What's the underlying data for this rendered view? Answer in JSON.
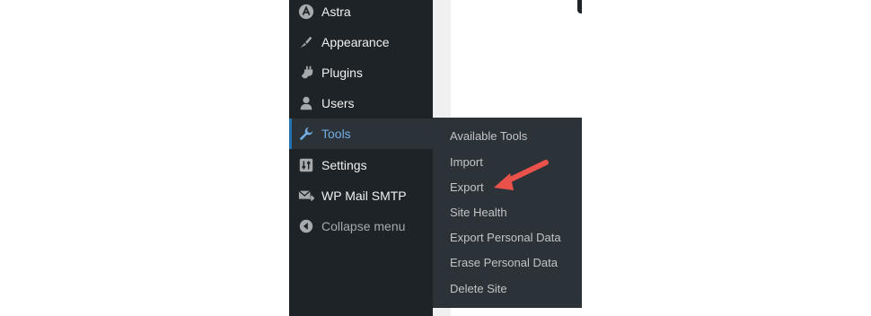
{
  "sidebar": {
    "items": [
      {
        "label": "Astra",
        "icon": "astra-icon"
      },
      {
        "label": "Appearance",
        "icon": "paintbrush-icon"
      },
      {
        "label": "Plugins",
        "icon": "plug-icon"
      },
      {
        "label": "Users",
        "icon": "user-icon"
      },
      {
        "label": "Tools",
        "icon": "wrench-icon",
        "active": true
      },
      {
        "label": "Settings",
        "icon": "sliders-icon"
      },
      {
        "label": "WP Mail SMTP",
        "icon": "mail-icon"
      }
    ],
    "collapse_label": "Collapse menu"
  },
  "tools_submenu": {
    "items": [
      "Available Tools",
      "Import",
      "Export",
      "Site Health",
      "Export Personal Data",
      "Erase Personal Data",
      "Delete Site"
    ]
  },
  "colors": {
    "sidebar_bg": "#1d2327",
    "flyout_bg": "#2c3338",
    "active_text": "#72aee6",
    "active_bar": "#2271b1",
    "annotation_arrow": "#e9524a"
  }
}
